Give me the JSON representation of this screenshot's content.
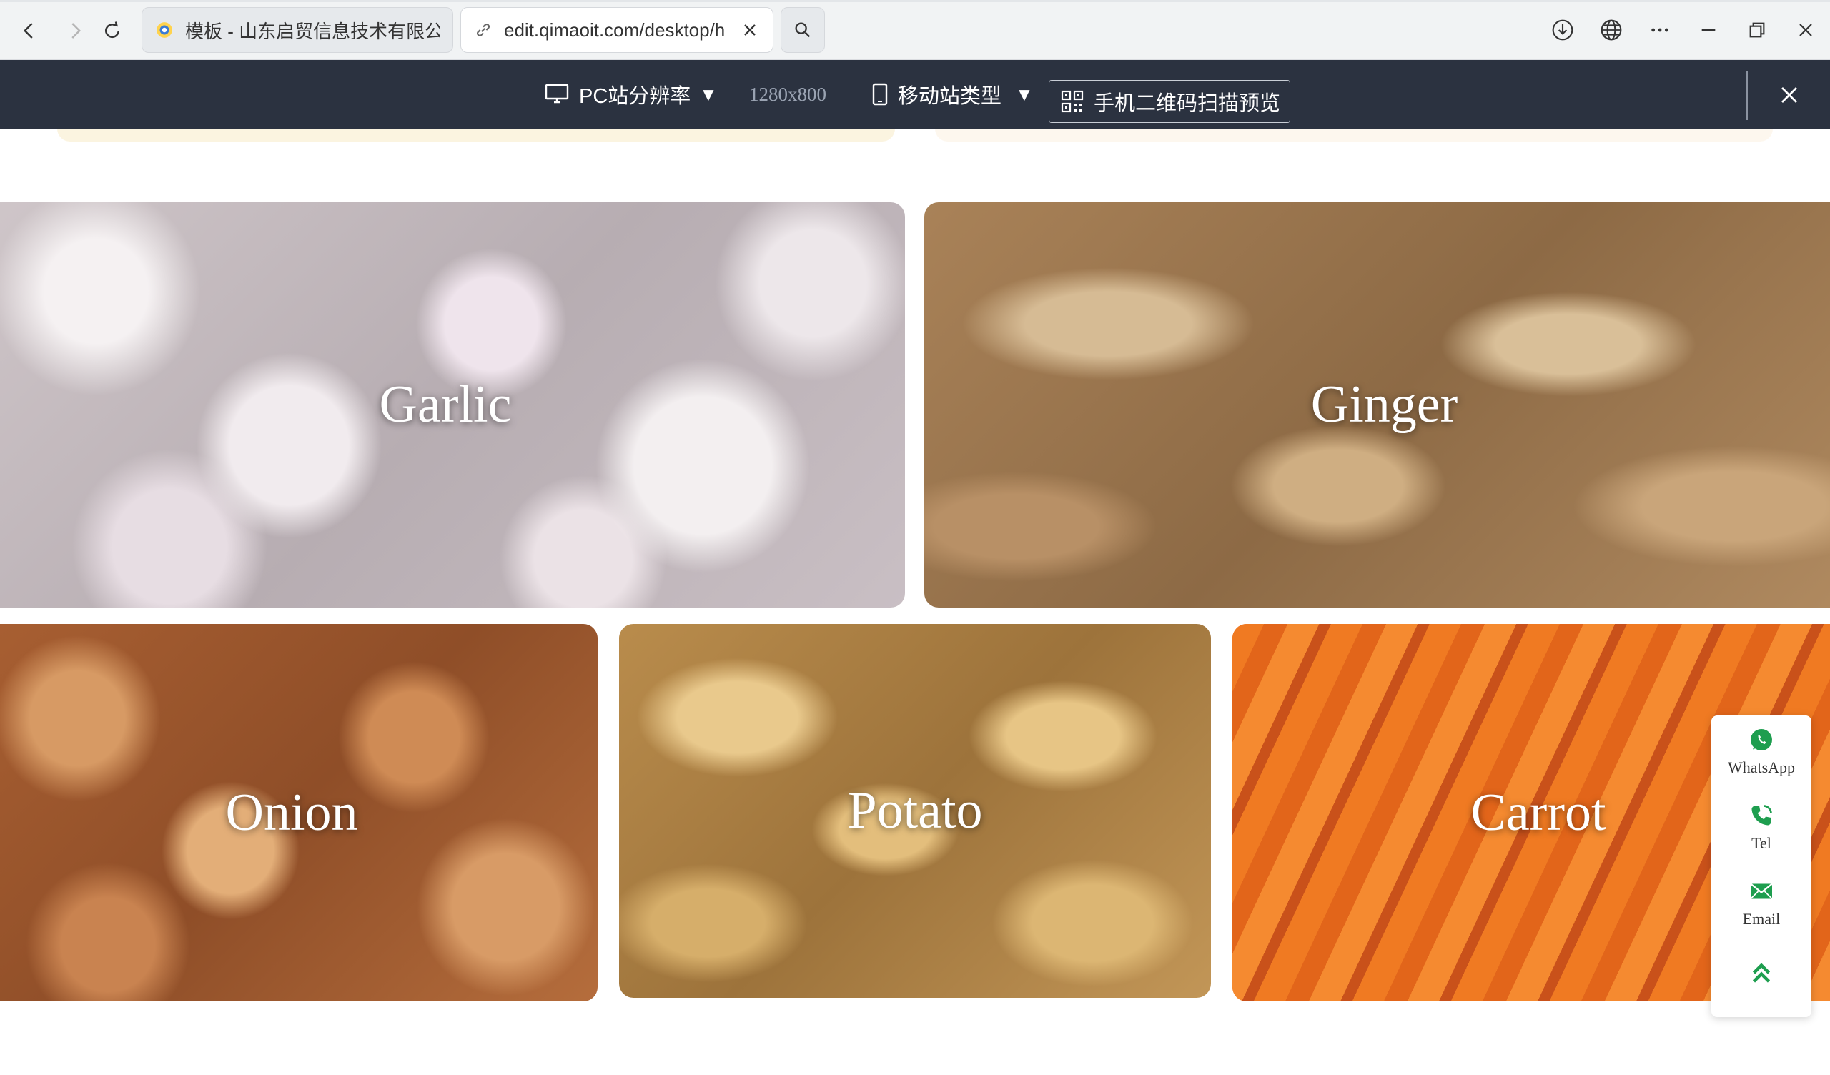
{
  "browser": {
    "tabs": [
      {
        "title": "模板 - 山东启贸信息技术有限公司",
        "active": false
      },
      {
        "title": "edit.qimaoit.com/desktop/h",
        "active": true
      }
    ],
    "icons": {
      "back": "back-arrow-icon",
      "forward": "forward-arrow-icon",
      "reload": "reload-icon",
      "search": "search-icon",
      "download": "download-icon",
      "globe": "globe-icon",
      "more": "more-icon",
      "minimize": "minimize-icon",
      "restore": "restore-icon",
      "close": "close-icon"
    }
  },
  "preview_bar": {
    "pc_label": "PC站分辨率",
    "pc_arrow": "▼",
    "resolution": "1280x800",
    "mobile_label": "移动站类型",
    "mobile_arrow": "▼",
    "qr_label": "手机二维码扫描预览"
  },
  "products": [
    {
      "name": "Garlic"
    },
    {
      "name": "Ginger"
    },
    {
      "name": "Onion"
    },
    {
      "name": "Potato"
    },
    {
      "name": "Carrot"
    }
  ],
  "contact": {
    "whatsapp": "WhatsApp",
    "tel": "Tel",
    "email": "Email",
    "accent_color": "#1e9e4f"
  }
}
